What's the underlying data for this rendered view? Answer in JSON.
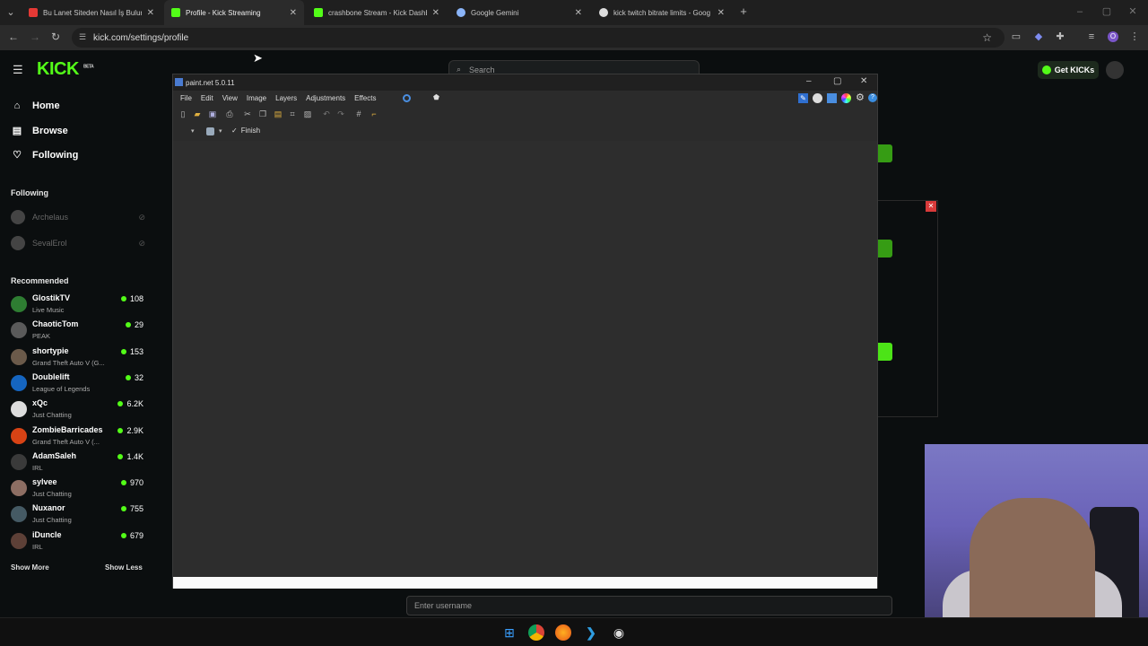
{
  "browser": {
    "tabs": [
      {
        "title": "Bu Lanet Siteden Nasıl İş Bulurs",
        "fav_color": "#e53935"
      },
      {
        "title": "Profile - Kick Streaming",
        "fav_color": "#53fc18"
      },
      {
        "title": "crashbone Stream - Kick Dashb",
        "fav_color": "#53fc18"
      },
      {
        "title": "Google Gemini",
        "fav_color": "#8ab4f8"
      },
      {
        "title": "kick twitch bitrate limits - Goog",
        "fav_color": "#dddddd"
      }
    ],
    "url": "kick.com/settings/profile"
  },
  "kick": {
    "logo": "KICK",
    "logo_badge": "BETA",
    "search_placeholder": "Search",
    "get_kicks": "Get KICKs",
    "nav": [
      {
        "label": "Home",
        "icon": "home-icon"
      },
      {
        "label": "Browse",
        "icon": "browse-icon"
      },
      {
        "label": "Following",
        "icon": "heart-icon"
      }
    ],
    "following_title": "Following",
    "following": [
      "Archelaus",
      "SevalErol"
    ],
    "recommended_title": "Recommended",
    "recommended": [
      {
        "name": "GlostikTV",
        "category": "Live Music",
        "viewers": "108",
        "color": "#2e7d32"
      },
      {
        "name": "ChaoticTom",
        "category": "PEAK",
        "viewers": "29",
        "color": "#5a5a5a"
      },
      {
        "name": "shortypie",
        "category": "Grand Theft Auto V (G...",
        "viewers": "153",
        "color": "#6b5a4a"
      },
      {
        "name": "Doublelift",
        "category": "League of Legends",
        "viewers": "32",
        "color": "#1565c0"
      },
      {
        "name": "xQc",
        "category": "Just Chatting",
        "viewers": "6.2K",
        "color": "#dddddd"
      },
      {
        "name": "ZombieBarricades",
        "category": "Grand Theft Auto V (...",
        "viewers": "2.9K",
        "color": "#d84315"
      },
      {
        "name": "AdamSaleh",
        "category": "IRL",
        "viewers": "1.4K",
        "color": "#3a3a3a"
      },
      {
        "name": "sylvee",
        "category": "Just Chatting",
        "viewers": "970",
        "color": "#8d6e63"
      },
      {
        "name": "Nuxanor",
        "category": "Just Chatting",
        "viewers": "755",
        "color": "#455a64"
      },
      {
        "name": "iDuncle",
        "category": "IRL",
        "viewers": "679",
        "color": "#5d4037"
      }
    ],
    "show_more": "Show More",
    "show_less": "Show Less",
    "username_placeholder": "Enter username"
  },
  "paintnet": {
    "title": "paint.net 5.0.11",
    "menu": [
      "File",
      "Edit",
      "View",
      "Image",
      "Layers",
      "Adjustments",
      "Effects"
    ],
    "finish_label": "Finish"
  }
}
